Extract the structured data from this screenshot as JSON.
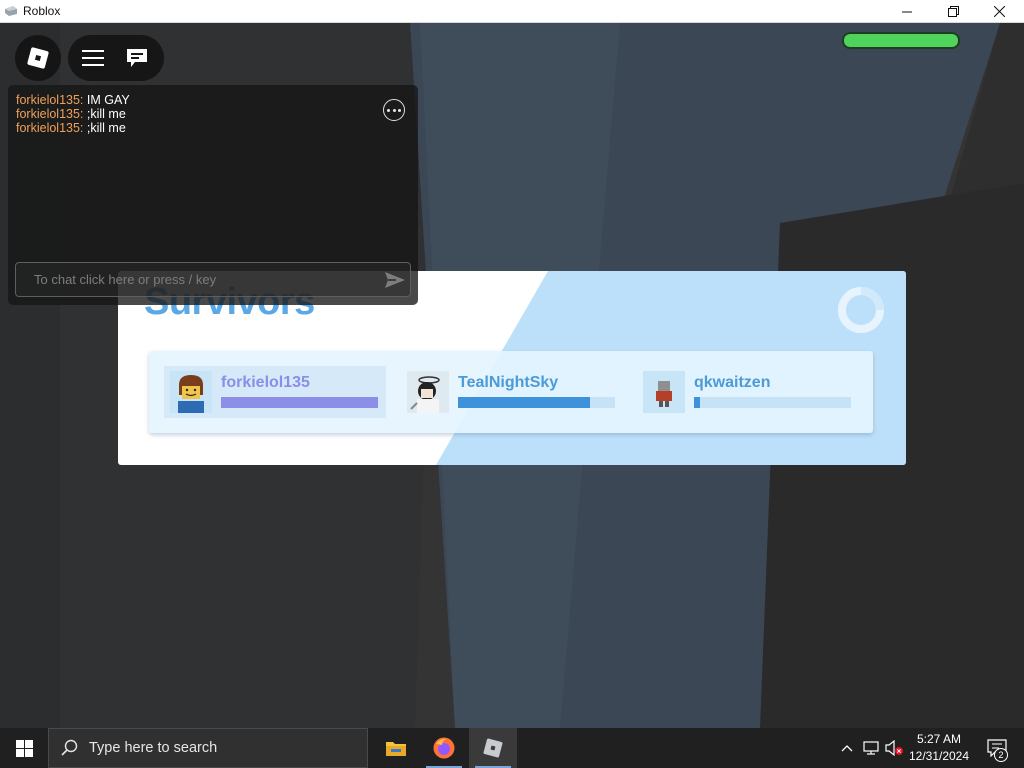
{
  "window": {
    "title": "Roblox",
    "controls": [
      "minimize-icon",
      "restore-icon",
      "close-icon"
    ]
  },
  "hud": {
    "health_fraction": 1.0,
    "health_color": "#4fd35b"
  },
  "chat": {
    "messages": [
      {
        "user": "forkielol135:",
        "text": "IM GAY"
      },
      {
        "user": "forkielol135:",
        "text": ";kill me"
      },
      {
        "user": "forkielol135:",
        "text": ";kill me"
      }
    ],
    "input_placeholder": "To chat click here or press / key",
    "username_color": "#f0a05a"
  },
  "survivors": {
    "heading": "Survivors",
    "players": [
      {
        "name": "forkielol135",
        "progress": 1.0,
        "selected": true
      },
      {
        "name": "TealNightSky",
        "progress": 0.84,
        "selected": false
      },
      {
        "name": "qkwaitzen",
        "progress": 0.04,
        "selected": false
      }
    ],
    "accent_color": "#5aa8e6"
  },
  "taskbar": {
    "search_placeholder": "Type here to search",
    "apps": [
      "file-explorer-icon",
      "firefox-icon",
      "roblox-icon"
    ],
    "active_app": "roblox-icon",
    "clock_time": "5:27 AM",
    "clock_date": "12/31/2024",
    "notification_count": "2"
  }
}
